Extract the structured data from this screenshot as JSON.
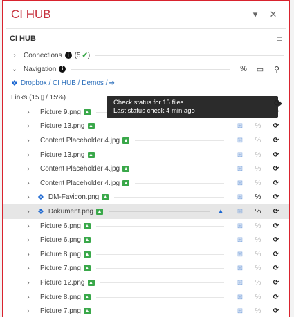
{
  "titlebar": {
    "title": "CI HUB",
    "dropdown_icon": "chevron-down-icon",
    "close_icon": "close-icon"
  },
  "header": {
    "name": "CI HUB",
    "menu_icon": "hamburger-icon"
  },
  "connections": {
    "label": "Connections",
    "count": "(5",
    "check": "✔",
    "close_paren": ")"
  },
  "navigation": {
    "label": "Navigation"
  },
  "breadcrumb": {
    "path": "Dropbox / CI HUB / Demos /",
    "arrow": "➔"
  },
  "links": {
    "label": "Links (15",
    "sep": "/ 15",
    "close": ")"
  },
  "tooltip": {
    "line1": "Check status for 15 files",
    "line2": "Last status check 4 min ago"
  },
  "files": [
    {
      "name": "Picture 9.png",
      "badge": true
    },
    {
      "name": "Picture 13.png",
      "badge": true
    },
    {
      "name": "Content Placeholder 4.jpg",
      "badge": true
    },
    {
      "name": "Picture 13.png",
      "badge": true
    },
    {
      "name": "Content Placeholder 4.jpg",
      "badge": true
    },
    {
      "name": "Content Placeholder 4.jpg",
      "badge": true
    },
    {
      "name": "DM-Favicon.png",
      "badge": true,
      "dropbox": true
    },
    {
      "name": "Dokument.png",
      "badge": true,
      "dropbox": true,
      "selected": true,
      "warning": true
    },
    {
      "name": "Picture 6.png",
      "badge": true
    },
    {
      "name": "Picture 6.png",
      "badge": true
    },
    {
      "name": "Picture 8.png",
      "badge": true
    },
    {
      "name": "Picture 7.png",
      "badge": true
    },
    {
      "name": "Picture 12.png",
      "badge": true
    },
    {
      "name": "Picture 8.png",
      "badge": true
    },
    {
      "name": "Picture 7.png",
      "badge": true
    }
  ]
}
